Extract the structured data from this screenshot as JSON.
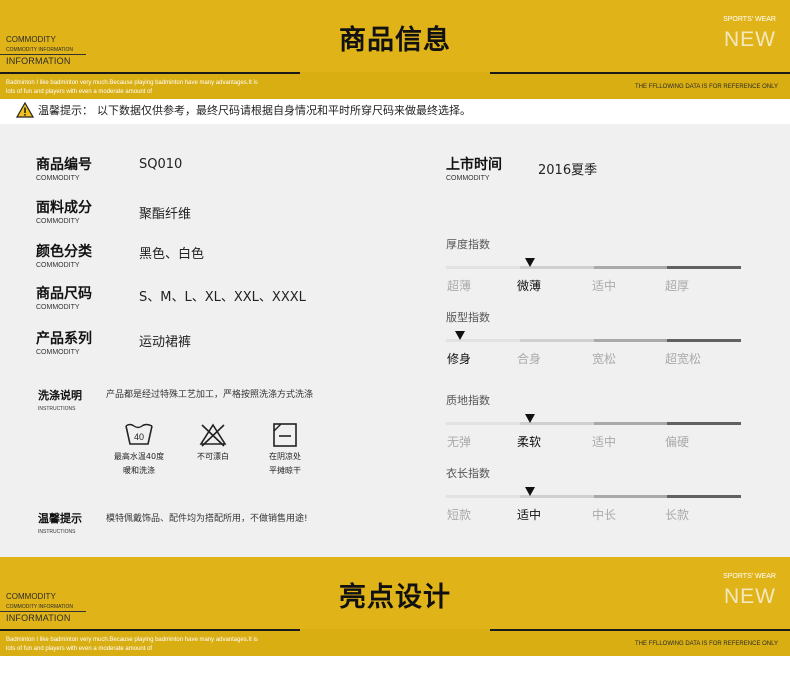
{
  "banner_top": {
    "title": "商品信息",
    "commodity": "COMMODITY",
    "commodity_info": "COMMODITY INFORMATION",
    "information": "INFORMATION",
    "sports_wear": "SPORTS’ WEAR",
    "new": "NEW",
    "description": "Badminton I like badminton very much.Because playing badminton have many advantages.It is lots of fun and players with even a moderate amount of",
    "reference": "THE FFLLOWING DATA IS FOR REFERENCE ONLY"
  },
  "banner_bottom": {
    "title": "亮点设计",
    "commodity": "COMMODITY",
    "commodity_info": "COMMODITY INFORMATION",
    "information": "INFORMATION",
    "sports_wear": "SPORTS’ WEAR",
    "new": "NEW",
    "description": "Badminton I like badminton very much.Because playing badminton have many advantages.It is lots of fun and players with even a moderate amount of",
    "reference": "THE FFLLOWING DATA IS FOR REFERENCE ONLY"
  },
  "warning": {
    "label": "温馨提示：",
    "text": "以下数据仅供参考，最终尺码请根据自身情况和平时所穿尺码来做最终选择。"
  },
  "info": {
    "code": {
      "label": "商品编号",
      "en": "COMMODITY",
      "value": "SQ010"
    },
    "material": {
      "label": "面料成分",
      "en": "COMMODITY",
      "value": "聚酯纤维"
    },
    "color": {
      "label": "颜色分类",
      "en": "COMMODITY",
      "value": "黑色、白色"
    },
    "size": {
      "label": "商品尺码",
      "en": "COMMODITY",
      "value": "S、M、L、XL、XXL、XXXL"
    },
    "series": {
      "label": "产品系列",
      "en": "COMMODITY",
      "value": "运动裙裤"
    },
    "launch": {
      "label": "上市时间",
      "en": "COMMODITY",
      "value": "2016夏季"
    }
  },
  "wash": {
    "label": "洗涤说明",
    "en": "INSTRUCTIONS",
    "desc": "产品都是经过特殊工艺加工，严格按照洗涤方式洗涤",
    "icons": [
      {
        "icon": "wash-40-icon",
        "number": "40",
        "line1": "最高水温40度",
        "line2": "暖和洗涤"
      },
      {
        "icon": "no-bleach-icon",
        "line1": "不可漂白",
        "line2": ""
      },
      {
        "icon": "dry-flat-shade-icon",
        "line1": "在阴凉处",
        "line2": "平摊晾干"
      }
    ]
  },
  "tip": {
    "label": "温馨提示",
    "en": "INSTRUCTIONS",
    "text": "模特佩戴饰品、配件均为搭配所用，不做销售用途!"
  },
  "indices": [
    {
      "title": "厚度指数",
      "options": [
        "超薄",
        "微薄",
        "适中",
        "超厚"
      ],
      "selected": 1
    },
    {
      "title": "版型指数",
      "options": [
        "修身",
        "合身",
        "宽松",
        "超宽松"
      ],
      "selected": 0
    },
    {
      "title": "质地指数",
      "options": [
        "无弹",
        "柔软",
        "适中",
        "偏硬"
      ],
      "selected": 1
    },
    {
      "title": "衣长指数",
      "options": [
        "短款",
        "适中",
        "中长",
        "长款"
      ],
      "selected": 1
    }
  ],
  "colors": {
    "banner": "#e0b419",
    "panel": "#f0f0f0",
    "selected_text": "#111111",
    "unselected_text": "#aaaaaa"
  }
}
